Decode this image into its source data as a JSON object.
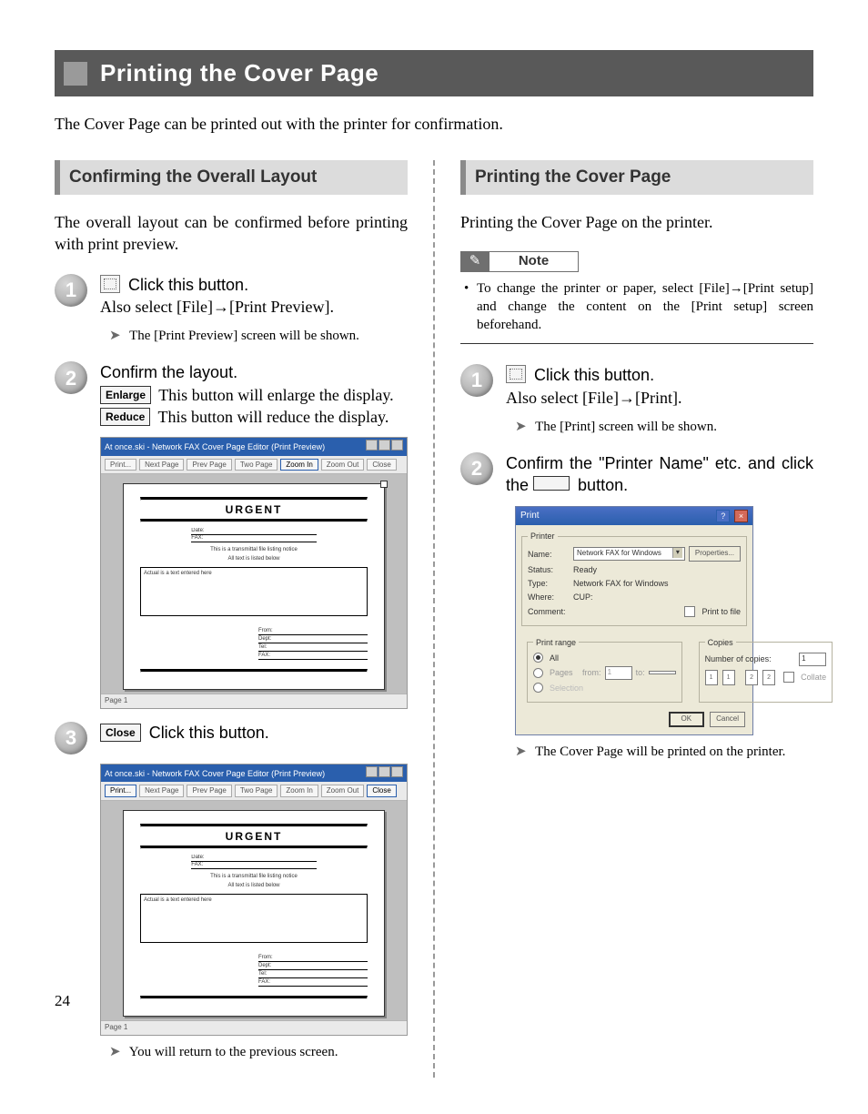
{
  "page_number": "24",
  "title": "Printing the Cover Page",
  "intro": "The Cover Page can be printed out with the printer for confirmation.",
  "left": {
    "section_title": "Confirming the Overall Layout",
    "section_intro": "The overall layout can be confirmed before printing with print preview.",
    "step1_line1": "Click this button.",
    "step1_line2": "Also select [File]→[Print Preview].",
    "step1_result": "The [Print Preview] screen will be shown.",
    "step2_line1": "Confirm the layout.",
    "step2_enlarge_btn": "Enlarge",
    "step2_enlarge_text": " This button will enlarge the display.",
    "step2_reduce_btn": "Reduce",
    "step2_reduce_text": " This button will reduce the display.",
    "step3_close_btn": "Close",
    "step3_text": " Click this button.",
    "step3_result": "You will return to the previous screen."
  },
  "right": {
    "section_title": "Printing the Cover Page",
    "section_intro": "Printing the Cover Page on the printer.",
    "note_label": "Note",
    "note_body": "To change the printer or paper, select [File]→[Print setup] and change the content on the [Print setup] screen beforehand.",
    "step1_line1": "Click this button.",
    "step1_line2": "Also select [File]→[Print].",
    "step1_result": "The [Print] screen will be shown.",
    "step2_text_a": "Confirm the \"Printer Name\" etc. and click the ",
    "step2_text_b": " button.",
    "step2_result": "The Cover Page will be printed on the printer."
  },
  "preview_window": {
    "title": "At once.ski - Network FAX Cover Page Editor (Print Preview)",
    "toolbar": {
      "print": "Print...",
      "next": "Next Page",
      "prev": "Prev Page",
      "two": "Two Page",
      "zoom_in": "Zoom In",
      "zoom_out": "Zoom Out",
      "close": "Close"
    },
    "urgent_label": "URGENT",
    "header_rows": [
      "Date:",
      "FAX:"
    ],
    "tiny_line_a": "This is a transmittal file listing notice",
    "tiny_line_b": "All text is listed below",
    "body_placeholder": "Actual is a text entered here",
    "sig_rows": [
      "From:",
      "Dept:",
      "Tel:",
      "FAX:"
    ],
    "status": "Page 1"
  },
  "print_dialog": {
    "title": "Print",
    "sections": {
      "printer": "Printer",
      "print_range": "Print range",
      "copies": "Copies"
    },
    "labels": {
      "name": "Name:",
      "status": "Status:",
      "type": "Type:",
      "where": "Where:",
      "comment": "Comment:",
      "properties": "Properties...",
      "print_to_file": "Print to file",
      "all": "All",
      "pages": "Pages",
      "from": "from:",
      "to": "to:",
      "selection": "Selection",
      "num_copies": "Number of copies:",
      "collate": "Collate",
      "ok": "OK",
      "cancel": "Cancel"
    },
    "values": {
      "name": "Network FAX for Windows",
      "status": "Ready",
      "type": "Network FAX for Windows",
      "where": "CUP:",
      "from": "1",
      "copies": "1"
    }
  }
}
